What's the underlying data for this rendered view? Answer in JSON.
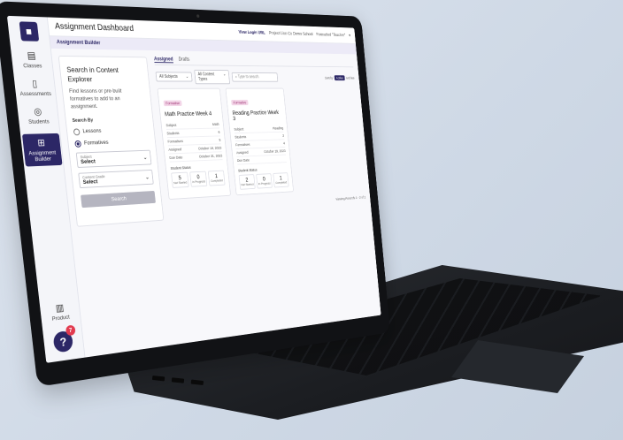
{
  "sidebar": {
    "items": [
      {
        "label": "Classes",
        "icon": "classes-icon"
      },
      {
        "label": "Assessments",
        "icon": "document-icon"
      },
      {
        "label": "Students",
        "icon": "students-icon"
      },
      {
        "label": "Assignment Builder",
        "icon": "builder-icon"
      }
    ],
    "product_label": "Product",
    "help_badge": "7",
    "help_glyph": "?"
  },
  "header": {
    "title": "Assignment Dashboard",
    "view_login": "View Login URL",
    "school": "Project Lion Co Demo School",
    "role": "Formatted \"Teacher\""
  },
  "subheader": {
    "label": "Assignment Builder"
  },
  "search_panel": {
    "title": "Search in Content Explorer",
    "description": "Find lessons or pre-built formatives to add to an assignment.",
    "search_by": "Search By",
    "options": [
      "Lessons",
      "Formatives"
    ],
    "selected_option": "Formatives",
    "subject_label": "Subject",
    "subject_value": "Select",
    "grade_label": "Content Grade",
    "grade_value": "Select",
    "search_button": "Search"
  },
  "tabs": [
    "Assigned",
    "Drafts"
  ],
  "active_tab": "Assigned",
  "filters": {
    "subjects": "All Subjects",
    "types": "All Content Types",
    "search_placeholder": "Type to search",
    "sort_label": "Sort by",
    "sort_active": "Active",
    "sort_other": "Archive"
  },
  "cards": [
    {
      "tag": "Formative",
      "title": "Math Practice Week 4",
      "rows": [
        {
          "label": "Subject",
          "value": "Math"
        },
        {
          "label": "Students",
          "value": "6"
        },
        {
          "label": "Formatives",
          "value": "5"
        },
        {
          "label": "Assigned",
          "value": "October 19, 2023"
        },
        {
          "label": "Due Date",
          "value": "October 31, 2023"
        }
      ],
      "status_label": "Student Status",
      "stats": [
        {
          "num": "5",
          "cap": "Not Started"
        },
        {
          "num": "0",
          "cap": "In Progress"
        },
        {
          "num": "1",
          "cap": "Completed"
        }
      ]
    },
    {
      "tag": "Formative",
      "title": "Reading Practice Week 3",
      "rows": [
        {
          "label": "Subject",
          "value": "Reading"
        },
        {
          "label": "Students",
          "value": "3"
        },
        {
          "label": "Formatives",
          "value": "4"
        },
        {
          "label": "Assigned",
          "value": "October 19, 2023"
        },
        {
          "label": "Due Date",
          "value": ""
        }
      ],
      "status_label": "Student Status",
      "stats": [
        {
          "num": "2",
          "cap": "Not Started"
        },
        {
          "num": "0",
          "cap": "In Progress"
        },
        {
          "num": "1",
          "cap": "Completed"
        }
      ]
    }
  ],
  "viewing": "Viewing Records 1 - 2 of 2",
  "colors": {
    "brand": "#2c2766",
    "tag_bg": "#f3d6e8",
    "badge": "#e23b4f"
  }
}
